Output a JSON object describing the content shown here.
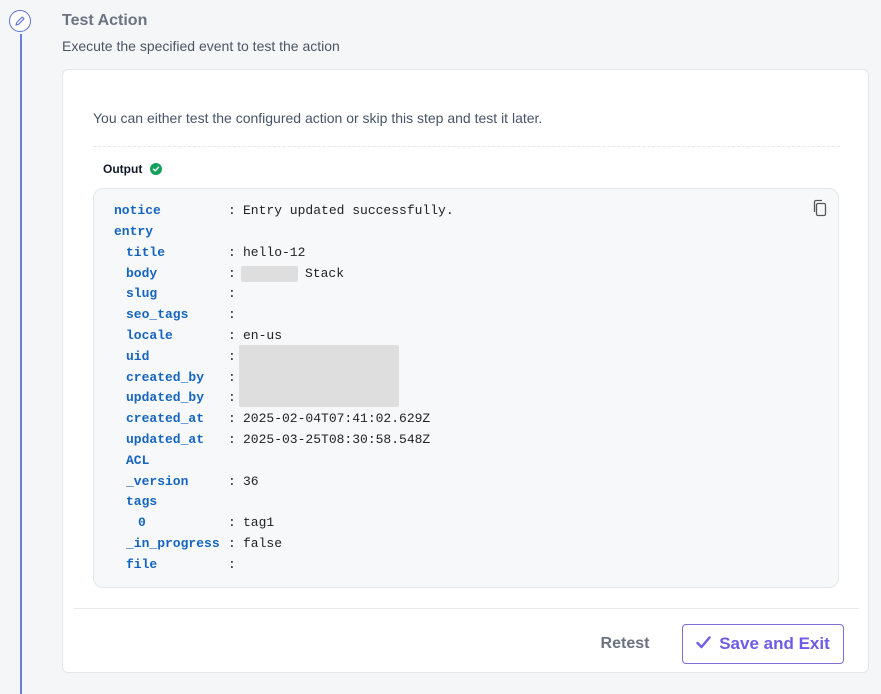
{
  "step": {
    "title": "Test Action",
    "subtitle": "Execute the specified event to test the action",
    "icon": "pencil-icon"
  },
  "card": {
    "intro": "You can either test the configured action or skip this step and test it later."
  },
  "output": {
    "label": "Output",
    "status_icon": "check-circle-icon",
    "rows": [
      {
        "key": "notice",
        "value": "Entry updated successfully."
      },
      {
        "key": "entry",
        "value": ""
      },
      {
        "key": "title",
        "value": "hello-12"
      },
      {
        "key": "body",
        "value": "Stack"
      },
      {
        "key": "slug",
        "value": ""
      },
      {
        "key": "seo_tags",
        "value": ""
      },
      {
        "key": "locale",
        "value": "en-us"
      },
      {
        "key": "uid",
        "value": ""
      },
      {
        "key": "created_by",
        "value": ""
      },
      {
        "key": "updated_by",
        "value": ""
      },
      {
        "key": "created_at",
        "value": "2025-02-04T07:41:02.629Z"
      },
      {
        "key": "updated_at",
        "value": "2025-03-25T08:30:58.548Z"
      },
      {
        "key": "ACL",
        "value": ""
      },
      {
        "key": "_version",
        "value": "36"
      },
      {
        "key": "tags",
        "value": ""
      },
      {
        "key": "0",
        "value": "tag1"
      },
      {
        "key": "_in_progress",
        "value": "false"
      },
      {
        "key": "file",
        "value": ""
      }
    ]
  },
  "footer": {
    "retest_label": "Retest",
    "save_label": "Save and Exit"
  },
  "colors": {
    "accent": "#6c5ce7",
    "key": "#1565c0",
    "success": "#12a05c"
  }
}
